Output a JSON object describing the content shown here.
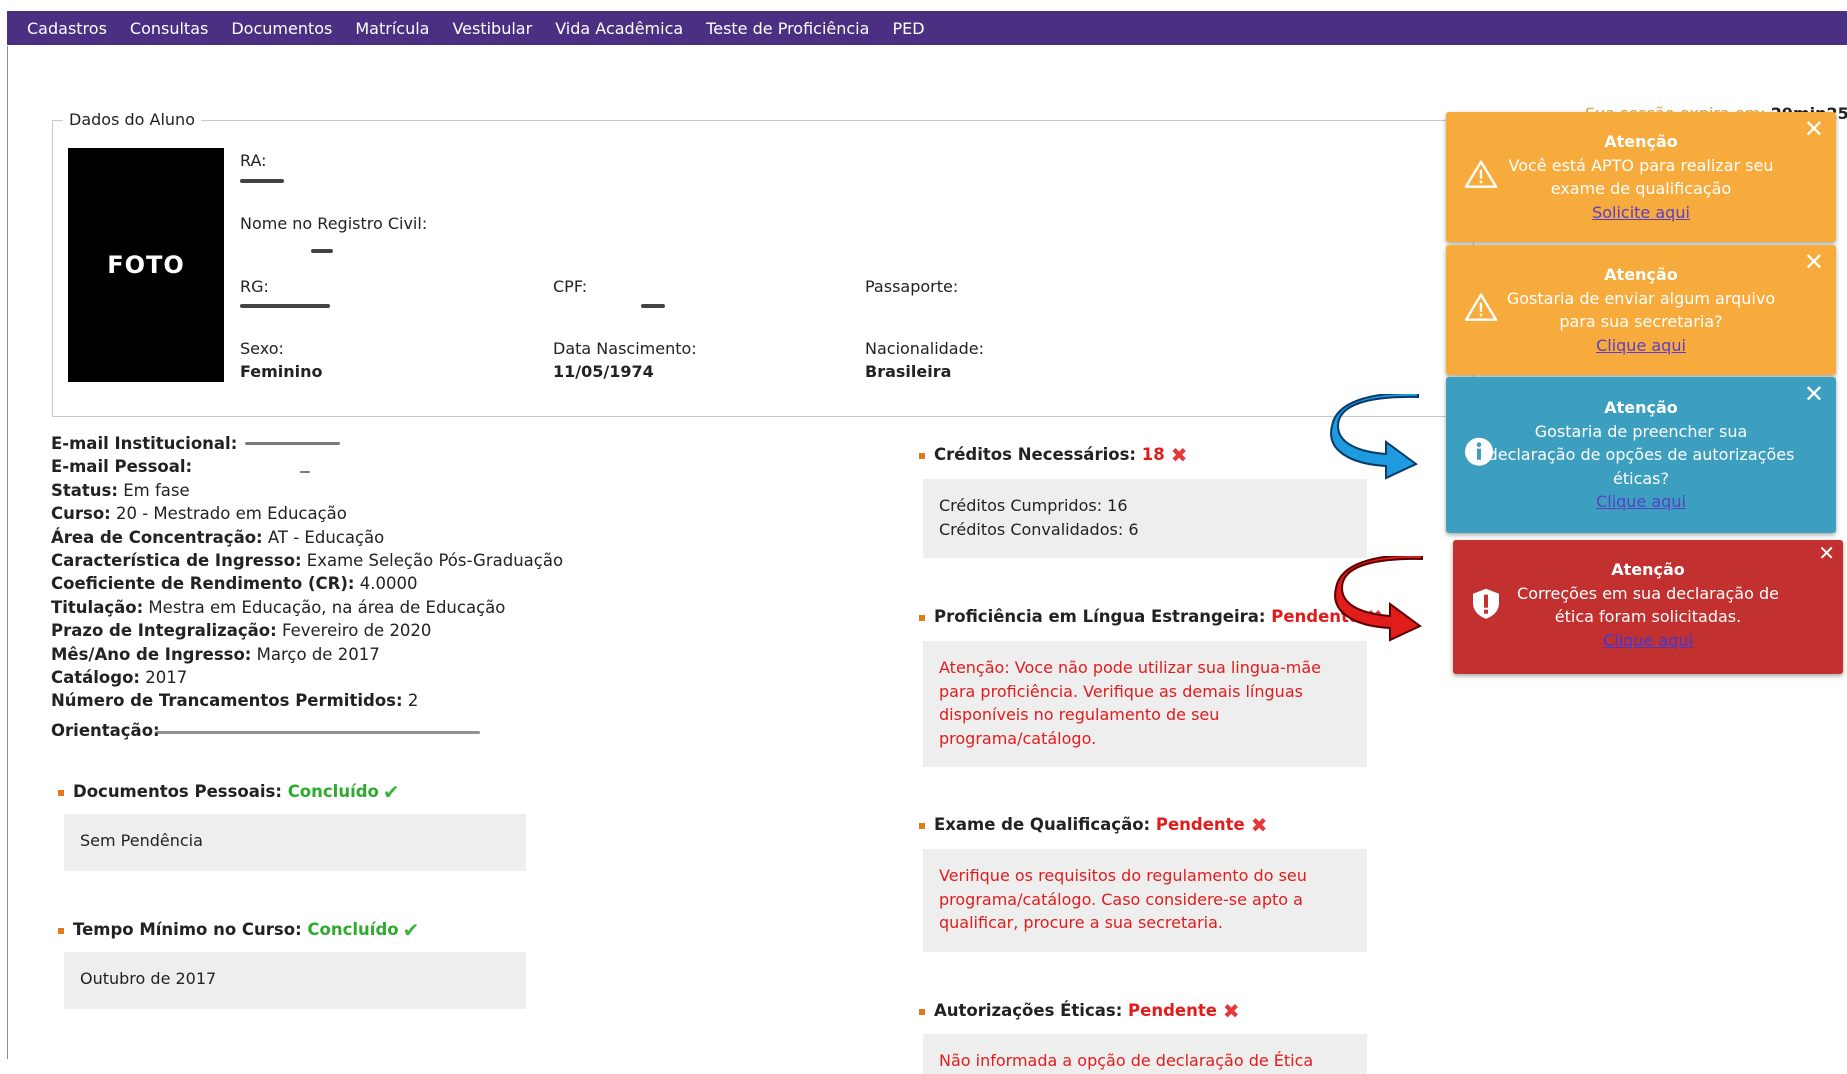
{
  "nav": [
    "Cadastros",
    "Consultas",
    "Documentos",
    "Matrícula",
    "Vestibular",
    "Vida Acadêmica",
    "Teste de Proficiência",
    "PED"
  ],
  "fieldset": {
    "legend": "Dados do Aluno",
    "photo_label": "FOTO",
    "ra_label": "RA:",
    "nome_label": "Nome no Registro Civil:",
    "rg_label": "RG:",
    "cpf_label": "CPF:",
    "passaporte_label": "Passaporte:",
    "sexo_label": "Sexo:",
    "sexo_value": "Feminino",
    "nasc_label": "Data Nascimento:",
    "nasc_value": "11/05/1974",
    "nac_label": "Nacionalidade:",
    "nac_value": "Brasileira"
  },
  "session": {
    "text": "Sua sessão expira em:",
    "time": "29min25"
  },
  "info": [
    {
      "label": "E-mail Institucional:",
      "value": ""
    },
    {
      "label": "E-mail Pessoal:",
      "value": ""
    },
    {
      "label": "Status:",
      "value": " Em fase"
    },
    {
      "label": "Curso:",
      "value": " 20 - Mestrado em Educação"
    },
    {
      "label": "Área de Concentração:",
      "value": " AT - Educação"
    },
    {
      "label": "Característica de Ingresso:",
      "value": " Exame Seleção Pós-Graduação"
    },
    {
      "label": "Coeficiente de Rendimento (CR):",
      "value": " 4.0000"
    },
    {
      "label": "Titulação:",
      "value": " Mestra em Educação, na área de Educação"
    },
    {
      "label": "Prazo de Integralização:",
      "value": " Fevereiro de 2020"
    },
    {
      "label": "Mês/Ano de Ingresso:",
      "value": " Março de 2017"
    },
    {
      "label": "Catálogo:",
      "value": " 2017"
    },
    {
      "label": "Número de Trancamentos Permitidos:",
      "value": " 2"
    },
    {
      "label": "Orientação:",
      "value": ""
    }
  ],
  "docs": {
    "title": "Documentos Pessoais:",
    "status": "Concluído",
    "box": "Sem Pendência"
  },
  "tempo": {
    "title": "Tempo Mínimo no Curso:",
    "status": "Concluído",
    "box": "Outubro de 2017"
  },
  "creditos": {
    "title": "Créditos Necessários:",
    "status": "18",
    "line1": "Créditos Cumpridos: 16",
    "line2": "Créditos Convalidados: 6"
  },
  "proficiencia": {
    "title": "Proficiência em Língua Estrangeira:",
    "status": "Pendente",
    "box": "Atenção: Voce não pode utilizar sua lingua-mãe para proficiência. Verifique as demais línguas disponíveis no regulamento de seu programa/catálogo."
  },
  "exame": {
    "title": "Exame de Qualificação:",
    "status": "Pendente",
    "box": "Verifique os requisitos do regulamento do seu programa/catálogo. Caso considere-se apto a qualificar, procure a sua secretaria."
  },
  "autorizacoes": {
    "title": "Autorizações Éticas:",
    "status": "Pendente",
    "box": "Não informada a opção de declaração de Ética"
  },
  "toasts": [
    {
      "title": "Atenção",
      "line1": "Você está APTO para realizar seu",
      "line2": "exame de qualificação",
      "link": "Solicite aqui"
    },
    {
      "title": "Atenção",
      "line1": "Gostaria de enviar algum arquivo",
      "line2": "para sua secretaria?",
      "link": "Clique aqui"
    },
    {
      "title": "Atenção",
      "line1": "Gostaria de preencher sua",
      "line2": "declaração de opções de autorizações",
      "line3": "éticas?",
      "link": "Clique aqui"
    },
    {
      "title": "Atenção",
      "line1": "Correções em sua declaração de",
      "line2": "ética foram solicitadas.",
      "link": "Clique aqui"
    }
  ],
  "colors": {
    "nav": "#4a2f82",
    "orange": "#f6ab3c",
    "blue": "#3c9fbf",
    "red": "#c23030",
    "ok": "#2eab2e",
    "bad": "#e21b1b"
  }
}
